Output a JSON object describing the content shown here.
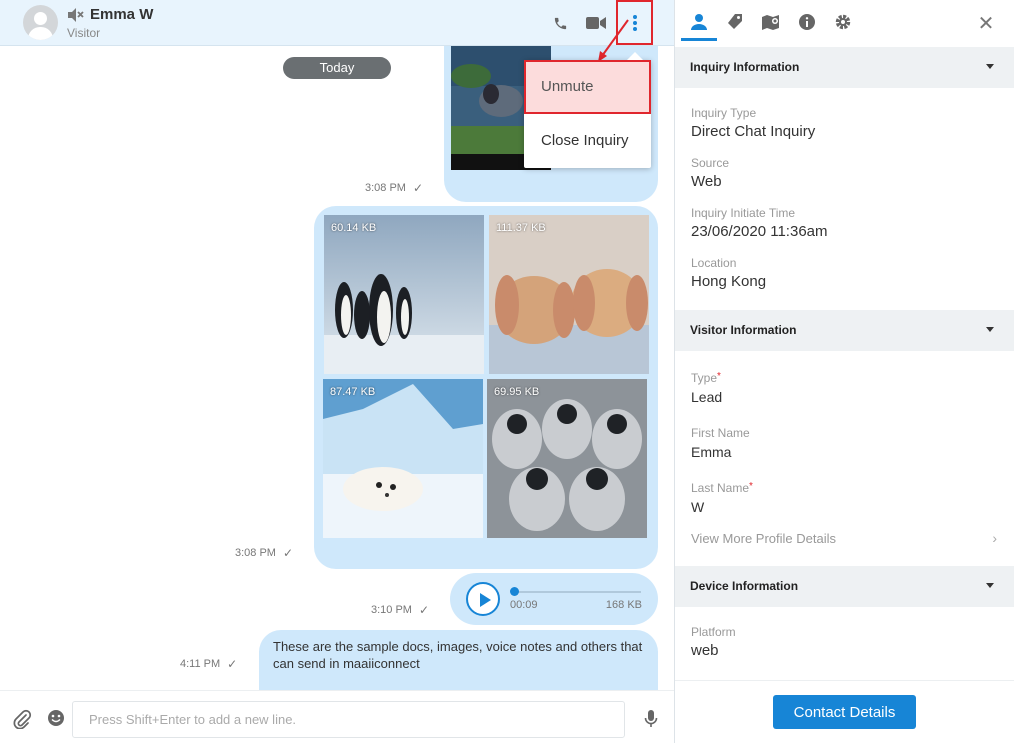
{
  "header": {
    "name": "Emma W",
    "role": "Visitor",
    "icons": [
      "mute-icon",
      "phone-icon",
      "video-icon",
      "more-vertical-icon"
    ]
  },
  "chat": {
    "date_divider": "Today",
    "messages": [
      {
        "type": "image",
        "time": "3:08 PM"
      },
      {
        "type": "image-grid",
        "time": "3:08 PM",
        "images": [
          {
            "size": "60.14 KB",
            "subject": "penguins"
          },
          {
            "size": "111.37 KB",
            "subject": "rabbits"
          },
          {
            "size": "87.47 KB",
            "subject": "seal-pup"
          },
          {
            "size": "69.95 KB",
            "subject": "penguin-chicks"
          }
        ]
      },
      {
        "type": "audio",
        "time": "3:10 PM",
        "duration": "00:09",
        "size": "168 KB"
      },
      {
        "type": "text",
        "time": "4:11 PM",
        "text": "These are the sample docs, images, voice notes and others that can send in maaiiconnect"
      }
    ],
    "composer_placeholder": "Press Shift+Enter to add a new line."
  },
  "dropdown": {
    "items": [
      "Unmute",
      "Close Inquiry"
    ]
  },
  "panel": {
    "tabs": [
      "person-icon",
      "tag-icon",
      "location-icon",
      "info-icon",
      "gear-icon"
    ],
    "inquiry": {
      "title": "Inquiry Information",
      "fields": [
        {
          "label": "Inquiry Type",
          "value": "Direct Chat Inquiry"
        },
        {
          "label": "Source",
          "value": "Web"
        },
        {
          "label": "Inquiry Initiate Time",
          "value": "23/06/2020 11:36am"
        },
        {
          "label": "Location",
          "value": "Hong Kong"
        }
      ]
    },
    "visitor": {
      "title": "Visitor Information",
      "fields": [
        {
          "label": "Type",
          "value": "Lead",
          "required": "*"
        },
        {
          "label": "First Name",
          "value": "Emma"
        },
        {
          "label": "Last Name",
          "value": "W",
          "required": "*"
        }
      ],
      "more_link": "View More Profile Details"
    },
    "device": {
      "title": "Device Information",
      "fields": [
        {
          "label": "Platform",
          "value": "web"
        }
      ]
    },
    "contact_button": "Contact Details"
  },
  "colors": {
    "accent": "#1785d6",
    "bubble": "#cfe8fb",
    "highlight": "#e0262d"
  }
}
